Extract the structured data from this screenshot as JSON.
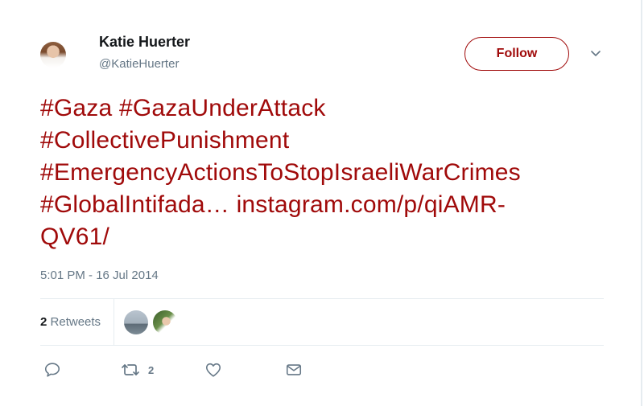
{
  "tweet": {
    "author": {
      "name": "Katie Huerter",
      "handle": "@KatieHuerter"
    },
    "follow_label": "Follow",
    "text_lines": [
      [
        "#Gaza",
        "#GazaUnderAttack"
      ],
      [
        "#CollectivePunishment"
      ],
      [
        "#EmergencyActionsToStopIsraeliWarCrimes"
      ],
      [
        "#GlobalIntifada…",
        "instagram.com/p/qiAMR-"
      ],
      [
        "QV61/"
      ]
    ],
    "timestamp": "5:01 PM - 16 Jul 2014",
    "stats": {
      "retweet_count": "2",
      "retweet_label": "Retweets"
    },
    "actions": {
      "retweet_count": "2"
    }
  },
  "colors": {
    "accent": "#a00a0a",
    "secondary_text": "#657786",
    "divider": "#e6ecf0"
  },
  "icons": [
    "reply-icon",
    "retweet-icon",
    "like-icon",
    "direct-message-icon",
    "chevron-down-icon"
  ]
}
